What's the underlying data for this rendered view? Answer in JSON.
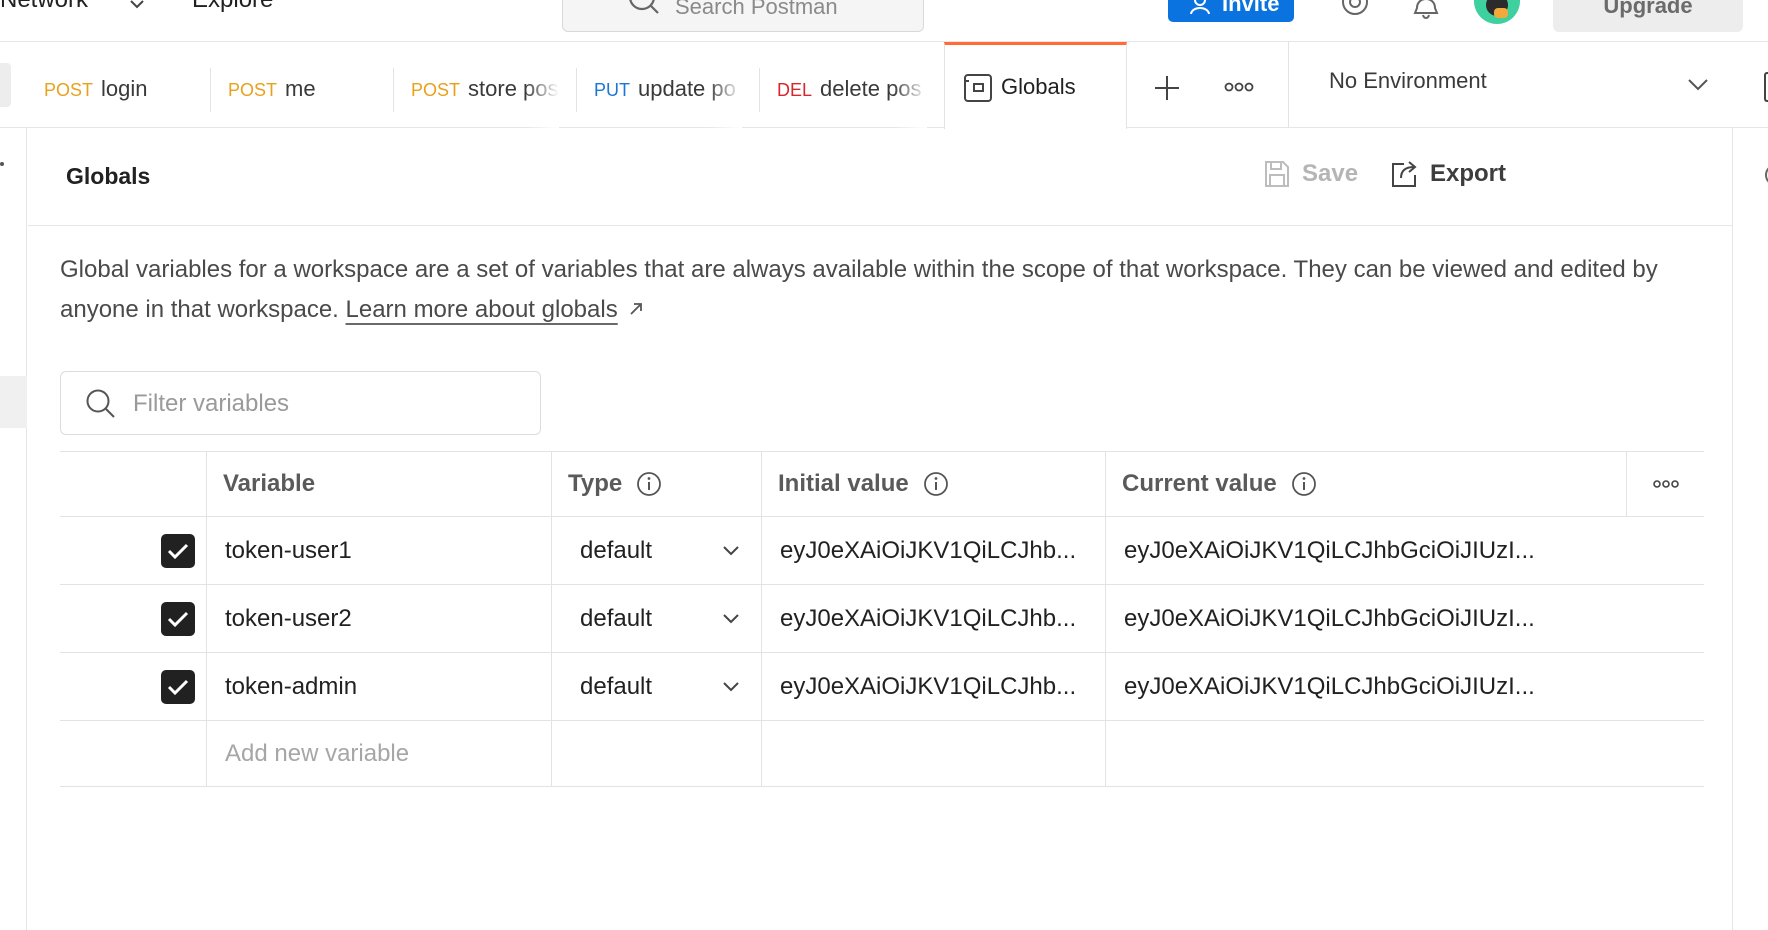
{
  "topbar": {
    "nav_network": "Network",
    "nav_explore": "Explore",
    "search_placeholder": "Search Postman",
    "invite_label": "Invite",
    "upgrade_label": "Upgrade"
  },
  "tabs": [
    {
      "method": "POST",
      "name": "login",
      "method_color": "#e8a11a"
    },
    {
      "method": "POST",
      "name": "me",
      "method_color": "#e8a11a"
    },
    {
      "method": "POST",
      "name": "store pos",
      "method_color": "#e8a11a"
    },
    {
      "method": "PUT",
      "name": "update po",
      "method_color": "#1c75d8"
    },
    {
      "method": "DEL",
      "name": "delete pos",
      "method_color": "#d9262c"
    }
  ],
  "active_tab": {
    "name": "Globals",
    "accent_color": "#ff6c37"
  },
  "environment": {
    "selected": "No Environment"
  },
  "globals": {
    "title": "Globals",
    "save_label": "Save",
    "export_label": "Export",
    "description": "Global variables for a workspace are a set of variables that are always available within the scope of that workspace. They can be viewed and edited by anyone in that workspace.",
    "learn_more": "Learn more about globals",
    "filter_placeholder": "Filter variables",
    "columns": {
      "variable": "Variable",
      "type": "Type",
      "initial_value": "Initial value",
      "current_value": "Current value"
    },
    "rows": [
      {
        "enabled": true,
        "variable": "token-user1",
        "type": "default",
        "initial_value": "eyJ0eXAiOiJKV1QiLCJhb...",
        "current_value": "eyJ0eXAiOiJKV1QiLCJhbGciOiJIUzI..."
      },
      {
        "enabled": true,
        "variable": "token-user2",
        "type": "default",
        "initial_value": "eyJ0eXAiOiJKV1QiLCJhb...",
        "current_value": "eyJ0eXAiOiJKV1QiLCJhbGciOiJIUzI..."
      },
      {
        "enabled": true,
        "variable": "token-admin",
        "type": "default",
        "initial_value": "eyJ0eXAiOiJKV1QiLCJhb...",
        "current_value": "eyJ0eXAiOiJKV1QiLCJhbGciOiJIUzI..."
      }
    ],
    "add_new_placeholder": "Add new variable"
  },
  "colors": {
    "invite_bg": "#0a73e0",
    "accent": "#ff6c37"
  }
}
